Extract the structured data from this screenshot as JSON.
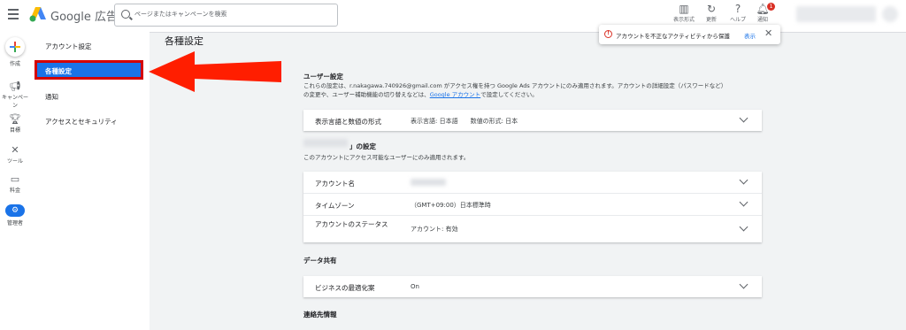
{
  "header": {
    "brand": "Google 広告",
    "search_placeholder": "ページまたはキャンペーンを検索",
    "tools": [
      {
        "label": "表示形式",
        "icon": "display-format-icon"
      },
      {
        "label": "更新",
        "icon": "refresh-icon"
      },
      {
        "label": "ヘルプ",
        "icon": "help-icon"
      },
      {
        "label": "通知",
        "icon": "bell-icon",
        "badge": "1"
      }
    ]
  },
  "rail": {
    "items": [
      {
        "label": "作成",
        "icon": "plus-icon"
      },
      {
        "label": "キャンペーン",
        "icon": "campaign-icon"
      },
      {
        "label": "目標",
        "icon": "trophy-icon"
      },
      {
        "label": "ツール",
        "icon": "tools-icon"
      },
      {
        "label": "料金",
        "icon": "billing-icon"
      },
      {
        "label": "管理者",
        "icon": "admin-gear-icon"
      }
    ]
  },
  "nav": {
    "items": [
      "アカウント設定",
      "各種設定",
      "通知",
      "アクセスとセキュリティ"
    ],
    "active": "各種設定"
  },
  "page": {
    "title": "各種設定"
  },
  "toast": {
    "message": "アカウントを不正なアクティビティから保護",
    "link": "表示"
  },
  "user_settings": {
    "title": "ユーザー設定",
    "desc_line1": "これらの設定は、r.nakagawa.740926@gmail.com がアクセス権を持つ Google Ads アカウントにのみ適用されます。アカウントの詳細設定（パスワードなど）",
    "desc_line2_prefix": "の変更や、ユーザー補助機能の切り替えなどは、",
    "desc_link": "Google アカウント",
    "desc_line2_suffix": "で設定してください。",
    "row_label": "表示言語と数値の形式",
    "row_value": "表示言語: 日本語　　数値の形式: 日本"
  },
  "account_settings": {
    "title_suffix": "」の設定",
    "desc": "このアカウントにアクセス可能なユーザーにのみ適用されます。",
    "rows": [
      {
        "label": "アカウント名",
        "value": ""
      },
      {
        "label": "タイムゾーン",
        "value": "（GMT+09:00）日本標準時"
      },
      {
        "label": "アカウントのステータス",
        "value": "アカウント: 有効"
      }
    ]
  },
  "data_sharing": {
    "title": "データ共有",
    "row_label": "ビジネスの最適化案",
    "row_value": "On"
  },
  "contact": {
    "title": "連絡先情報"
  }
}
